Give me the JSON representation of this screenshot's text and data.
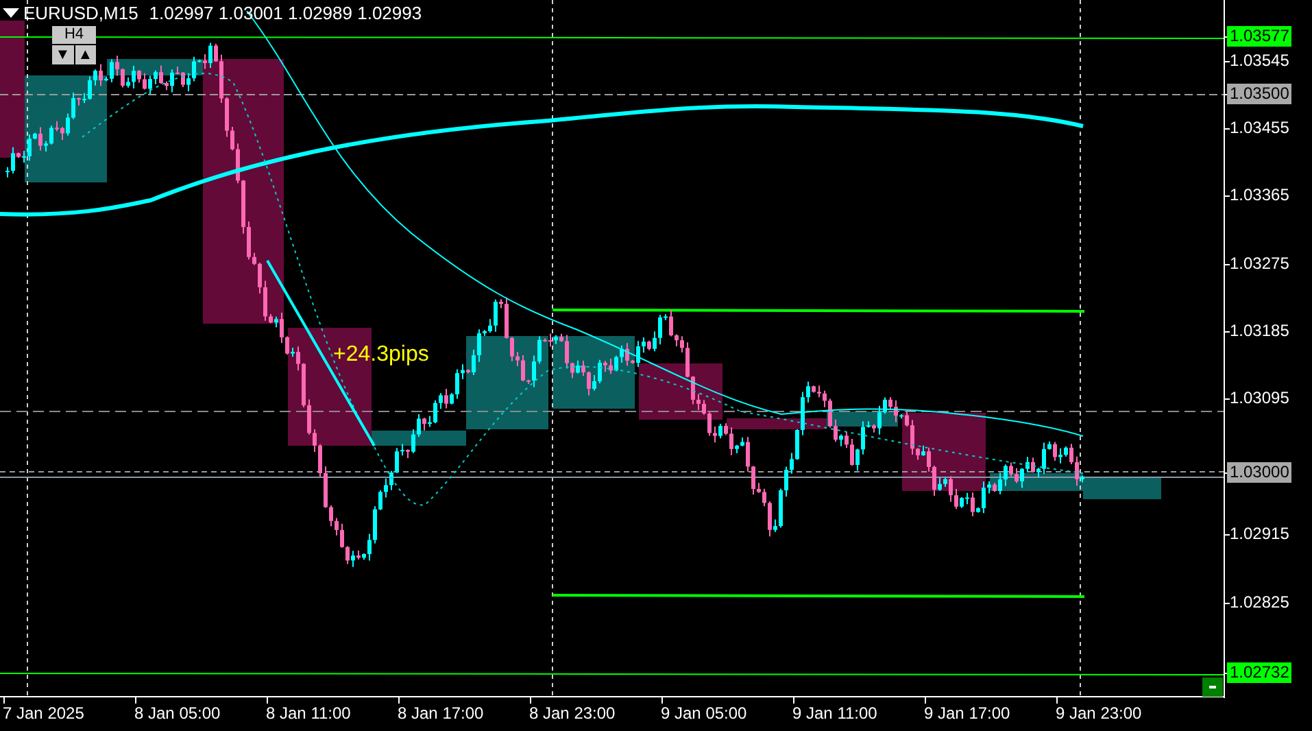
{
  "symbol_bar": {
    "title": "EURUSD,M15",
    "ohlc": [
      "1.02997",
      "1.03001",
      "1.02989",
      "1.02993"
    ]
  },
  "timeframe_panel": {
    "label": "H4",
    "buttons": [
      "▼",
      "▲"
    ]
  },
  "annotation": {
    "text": "+24.3pips"
  },
  "price_axis": [
    {
      "label": "1.03577",
      "kind": "level"
    },
    {
      "label": "1.03545",
      "kind": "tick"
    },
    {
      "label": "1.03500",
      "kind": "marker"
    },
    {
      "label": "1.03455",
      "kind": "tick"
    },
    {
      "label": "1.03365",
      "kind": "tick"
    },
    {
      "label": "1.03275",
      "kind": "tick"
    },
    {
      "label": "1.03185",
      "kind": "tick"
    },
    {
      "label": "1.03095",
      "kind": "tick"
    },
    {
      "label": "1.03000",
      "kind": "marker"
    },
    {
      "label": "1.02915",
      "kind": "tick"
    },
    {
      "label": "1.02825",
      "kind": "tick"
    },
    {
      "label": "1.02732",
      "kind": "level"
    }
  ],
  "time_axis": [
    "7 Jan 2025",
    "8 Jan 05:00",
    "8 Jan 11:00",
    "8 Jan 17:00",
    "8 Jan 23:00",
    "9 Jan 05:00",
    "9 Jan 11:00",
    "9 Jan 17:00",
    "9 Jan 23:00"
  ]
}
